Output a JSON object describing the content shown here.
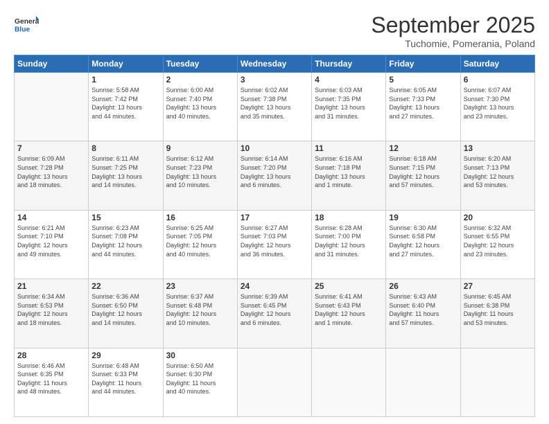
{
  "header": {
    "logo_general": "General",
    "logo_blue": "Blue",
    "month": "September 2025",
    "location": "Tuchomie, Pomerania, Poland"
  },
  "days_of_week": [
    "Sunday",
    "Monday",
    "Tuesday",
    "Wednesday",
    "Thursday",
    "Friday",
    "Saturday"
  ],
  "weeks": [
    [
      {
        "day": "",
        "info": ""
      },
      {
        "day": "1",
        "info": "Sunrise: 5:58 AM\nSunset: 7:42 PM\nDaylight: 13 hours\nand 44 minutes."
      },
      {
        "day": "2",
        "info": "Sunrise: 6:00 AM\nSunset: 7:40 PM\nDaylight: 13 hours\nand 40 minutes."
      },
      {
        "day": "3",
        "info": "Sunrise: 6:02 AM\nSunset: 7:38 PM\nDaylight: 13 hours\nand 35 minutes."
      },
      {
        "day": "4",
        "info": "Sunrise: 6:03 AM\nSunset: 7:35 PM\nDaylight: 13 hours\nand 31 minutes."
      },
      {
        "day": "5",
        "info": "Sunrise: 6:05 AM\nSunset: 7:33 PM\nDaylight: 13 hours\nand 27 minutes."
      },
      {
        "day": "6",
        "info": "Sunrise: 6:07 AM\nSunset: 7:30 PM\nDaylight: 13 hours\nand 23 minutes."
      }
    ],
    [
      {
        "day": "7",
        "info": "Sunrise: 6:09 AM\nSunset: 7:28 PM\nDaylight: 13 hours\nand 18 minutes."
      },
      {
        "day": "8",
        "info": "Sunrise: 6:11 AM\nSunset: 7:25 PM\nDaylight: 13 hours\nand 14 minutes."
      },
      {
        "day": "9",
        "info": "Sunrise: 6:12 AM\nSunset: 7:23 PM\nDaylight: 13 hours\nand 10 minutes."
      },
      {
        "day": "10",
        "info": "Sunrise: 6:14 AM\nSunset: 7:20 PM\nDaylight: 13 hours\nand 6 minutes."
      },
      {
        "day": "11",
        "info": "Sunrise: 6:16 AM\nSunset: 7:18 PM\nDaylight: 13 hours\nand 1 minute."
      },
      {
        "day": "12",
        "info": "Sunrise: 6:18 AM\nSunset: 7:15 PM\nDaylight: 12 hours\nand 57 minutes."
      },
      {
        "day": "13",
        "info": "Sunrise: 6:20 AM\nSunset: 7:13 PM\nDaylight: 12 hours\nand 53 minutes."
      }
    ],
    [
      {
        "day": "14",
        "info": "Sunrise: 6:21 AM\nSunset: 7:10 PM\nDaylight: 12 hours\nand 49 minutes."
      },
      {
        "day": "15",
        "info": "Sunrise: 6:23 AM\nSunset: 7:08 PM\nDaylight: 12 hours\nand 44 minutes."
      },
      {
        "day": "16",
        "info": "Sunrise: 6:25 AM\nSunset: 7:05 PM\nDaylight: 12 hours\nand 40 minutes."
      },
      {
        "day": "17",
        "info": "Sunrise: 6:27 AM\nSunset: 7:03 PM\nDaylight: 12 hours\nand 36 minutes."
      },
      {
        "day": "18",
        "info": "Sunrise: 6:28 AM\nSunset: 7:00 PM\nDaylight: 12 hours\nand 31 minutes."
      },
      {
        "day": "19",
        "info": "Sunrise: 6:30 AM\nSunset: 6:58 PM\nDaylight: 12 hours\nand 27 minutes."
      },
      {
        "day": "20",
        "info": "Sunrise: 6:32 AM\nSunset: 6:55 PM\nDaylight: 12 hours\nand 23 minutes."
      }
    ],
    [
      {
        "day": "21",
        "info": "Sunrise: 6:34 AM\nSunset: 6:53 PM\nDaylight: 12 hours\nand 18 minutes."
      },
      {
        "day": "22",
        "info": "Sunrise: 6:36 AM\nSunset: 6:50 PM\nDaylight: 12 hours\nand 14 minutes."
      },
      {
        "day": "23",
        "info": "Sunrise: 6:37 AM\nSunset: 6:48 PM\nDaylight: 12 hours\nand 10 minutes."
      },
      {
        "day": "24",
        "info": "Sunrise: 6:39 AM\nSunset: 6:45 PM\nDaylight: 12 hours\nand 6 minutes."
      },
      {
        "day": "25",
        "info": "Sunrise: 6:41 AM\nSunset: 6:43 PM\nDaylight: 12 hours\nand 1 minute."
      },
      {
        "day": "26",
        "info": "Sunrise: 6:43 AM\nSunset: 6:40 PM\nDaylight: 11 hours\nand 57 minutes."
      },
      {
        "day": "27",
        "info": "Sunrise: 6:45 AM\nSunset: 6:38 PM\nDaylight: 11 hours\nand 53 minutes."
      }
    ],
    [
      {
        "day": "28",
        "info": "Sunrise: 6:46 AM\nSunset: 6:35 PM\nDaylight: 11 hours\nand 48 minutes."
      },
      {
        "day": "29",
        "info": "Sunrise: 6:48 AM\nSunset: 6:33 PM\nDaylight: 11 hours\nand 44 minutes."
      },
      {
        "day": "30",
        "info": "Sunrise: 6:50 AM\nSunset: 6:30 PM\nDaylight: 11 hours\nand 40 minutes."
      },
      {
        "day": "",
        "info": ""
      },
      {
        "day": "",
        "info": ""
      },
      {
        "day": "",
        "info": ""
      },
      {
        "day": "",
        "info": ""
      }
    ]
  ]
}
